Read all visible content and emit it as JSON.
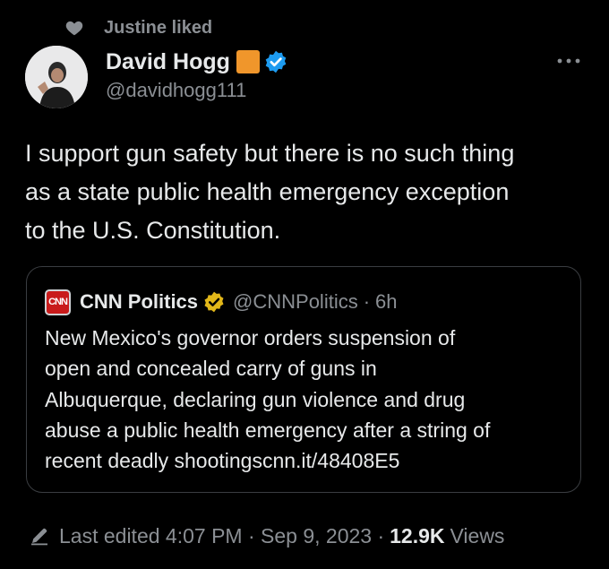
{
  "social_context": {
    "label": "Justine liked"
  },
  "author": {
    "name": "David Hogg",
    "handle": "@davidhogg111"
  },
  "tweet": {
    "lines": [
      "I support gun safety but there is no such thing",
      "as a state public health emergency exception",
      "to the U.S. Constitution."
    ]
  },
  "quote": {
    "logo_text": "CNN",
    "name": "CNN Politics",
    "handle": "@CNNPolitics",
    "time": "6h",
    "lines": [
      "New Mexico's governor orders suspension of",
      "open and concealed carry of guns in",
      "Albuquerque, declaring gun violence and drug",
      "abuse a public health emergency after a string of",
      "recent deadly shootingscnn.it/48408E5"
    ]
  },
  "footer": {
    "edited": "Last edited 4:07 PM · Sep 9, 2023 ·",
    "views_count": "12.9K",
    "views_label": "Views"
  },
  "colors": {
    "background": "#000000",
    "text": "#e7e9ea",
    "muted": "#8b8f94",
    "verified_blue": "#1d9bf0",
    "gold_badge": "#e2b719",
    "orange_emoji": "#f0962b",
    "cnn_red": "#c91b1b"
  },
  "icons": [
    "heart-icon",
    "verified-badge-icon",
    "more-icon",
    "cnn-logo",
    "gold-verified-badge-icon",
    "pencil-icon"
  ]
}
